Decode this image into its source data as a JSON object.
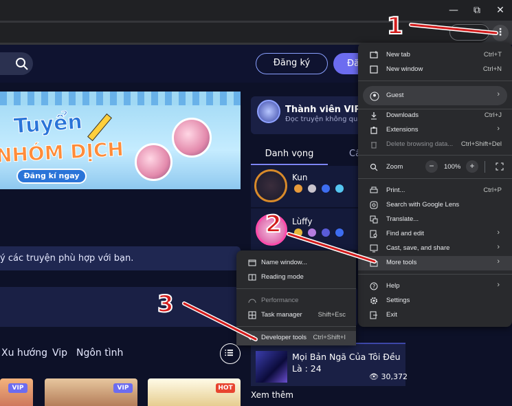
{
  "page": {
    "header": {
      "register_label": "Đăng ký",
      "login_label": "Đă"
    },
    "banner": {
      "line1": "Tuyển",
      "line2": "NHÓM DỊCH",
      "cta": "Đăng kí ngay"
    },
    "hint_text": "ý các truyện phù hợp với bạn.",
    "genres": [
      "Xu hướng",
      "Vip",
      "Ngôn tình"
    ],
    "tags": [
      "VIP",
      "VIP",
      "HOT"
    ],
    "vip": {
      "title": "Thành viên VIP",
      "subtitle": "Đọc truyện không quả"
    },
    "tabs": [
      "Danh vọng",
      "Cấ"
    ],
    "ranking": [
      {
        "name": "Kun"
      },
      {
        "name": "Lùffy"
      }
    ],
    "trending": {
      "title": "Mọi Bản Ngã Của Tôi Đều Là : 24",
      "views": "30,372"
    },
    "more_label": "Xem thêm"
  },
  "menu": {
    "items": [
      {
        "label": "New tab",
        "shortcut": "Ctrl+T"
      },
      {
        "label": "New window",
        "shortcut": "Ctrl+N"
      },
      {
        "label": "Guest"
      },
      {
        "label": "Downloads",
        "shortcut": "Ctrl+J"
      },
      {
        "label": "Extensions"
      },
      {
        "label": "Delete browsing data...",
        "shortcut": "Ctrl+Shift+Del"
      },
      {
        "label": "Zoom",
        "zoom_value": "100%"
      },
      {
        "label": "Print...",
        "shortcut": "Ctrl+P"
      },
      {
        "label": "Search with Google Lens"
      },
      {
        "label": "Translate..."
      },
      {
        "label": "Find and edit"
      },
      {
        "label": "Cast, save, and share"
      },
      {
        "label": "More tools"
      },
      {
        "label": "Help"
      },
      {
        "label": "Settings"
      },
      {
        "label": "Exit"
      }
    ]
  },
  "submenu": {
    "items": [
      {
        "label": "Name window..."
      },
      {
        "label": "Reading mode"
      },
      {
        "label": "Performance"
      },
      {
        "label": "Task manager",
        "shortcut": "Shift+Esc"
      },
      {
        "label": "Developer tools",
        "shortcut": "Ctrl+Shift+I"
      }
    ]
  },
  "annotations": [
    "1",
    "2",
    "3"
  ],
  "colors": {
    "menu_bg": "#292a2d",
    "page_bg": "#0d1128",
    "accent": "#6c6cf0",
    "annotation": "#d21c1c"
  }
}
